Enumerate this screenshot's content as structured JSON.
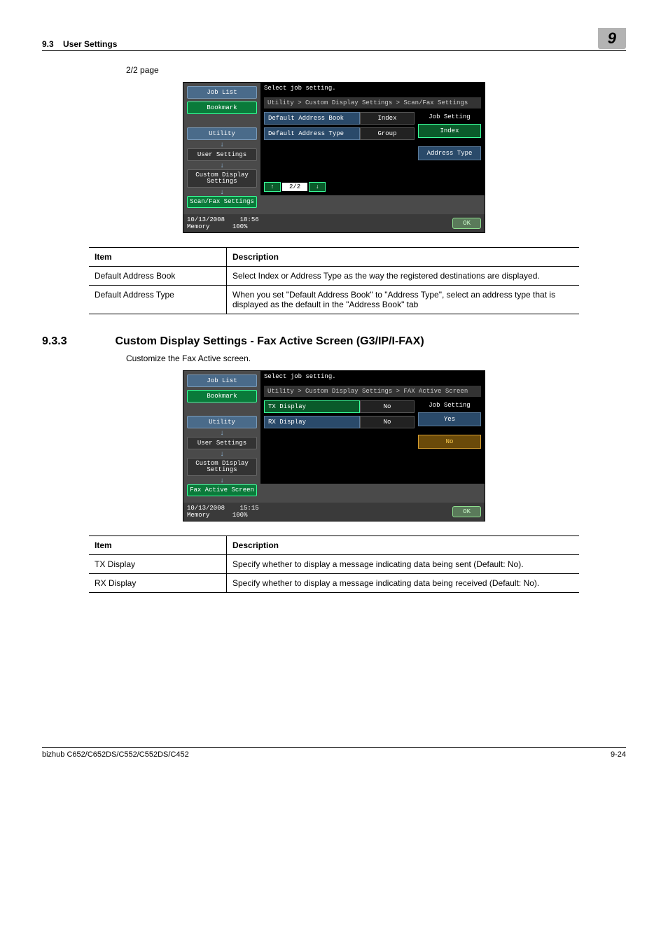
{
  "header": {
    "section_no": "9.3",
    "section_title": "User Settings",
    "page_tab": "9"
  },
  "page_label": "2/2 page",
  "shot1": {
    "side": {
      "job_list": "Job List",
      "bookmark": "Bookmark",
      "utility": "Utility",
      "user_settings": "User Settings",
      "custom": "Custom Display Settings",
      "scanfax": "Scan/Fax Settings"
    },
    "header": "Select job setting.",
    "breadcrumb": "Utility > Custom Display Settings > Scan/Fax Settings",
    "rows": [
      {
        "label": "Default Address Book",
        "value": "Index"
      },
      {
        "label": "Default Address Type",
        "value": "Group"
      }
    ],
    "right_header": "Job Setting",
    "right_buttons": [
      "Index",
      "Address Type"
    ],
    "pager": {
      "up": "↑",
      "down": "↓",
      "page": "2/2"
    },
    "footer": {
      "date": "10/13/2008",
      "time": "18:56",
      "mem_label": "Memory",
      "mem": "100%",
      "ok": "OK"
    }
  },
  "table1": {
    "headers": [
      "Item",
      "Description"
    ],
    "rows": [
      [
        "Default Address Book",
        "Select Index or Address Type as the way the registered destinations are displayed."
      ],
      [
        "Default Address Type",
        "When you set \"Default Address Book\" to \"Address Type\", select an address type that is displayed as the default in the \"Address Book\" tab"
      ]
    ]
  },
  "section": {
    "num": "9.3.3",
    "title": "Custom Display Settings - Fax Active Screen (G3/IP/I-FAX)",
    "body": "Customize the Fax Active screen."
  },
  "shot2": {
    "side": {
      "job_list": "Job List",
      "bookmark": "Bookmark",
      "utility": "Utility",
      "user_settings": "User Settings",
      "custom": "Custom Display Settings",
      "fax_active": "Fax Active Screen"
    },
    "header": "Select job setting.",
    "breadcrumb": "Utility > Custom Display Settings > FAX Active Screen",
    "rows": [
      {
        "label": "TX Display",
        "value": "No"
      },
      {
        "label": "RX Display",
        "value": "No"
      }
    ],
    "right_header": "Job Setting",
    "right_buttons": [
      "Yes",
      "No"
    ],
    "footer": {
      "date": "10/13/2008",
      "time": "15:15",
      "mem_label": "Memory",
      "mem": "100%",
      "ok": "OK"
    }
  },
  "table2": {
    "headers": [
      "Item",
      "Description"
    ],
    "rows": [
      [
        "TX Display",
        "Specify whether to display a message indicating data being sent (Default: No)."
      ],
      [
        "RX Display",
        "Specify whether to display a message indicating data being received (Default: No)."
      ]
    ]
  },
  "footer": {
    "model": "bizhub C652/C652DS/C552/C552DS/C452",
    "pagenum": "9-24"
  }
}
